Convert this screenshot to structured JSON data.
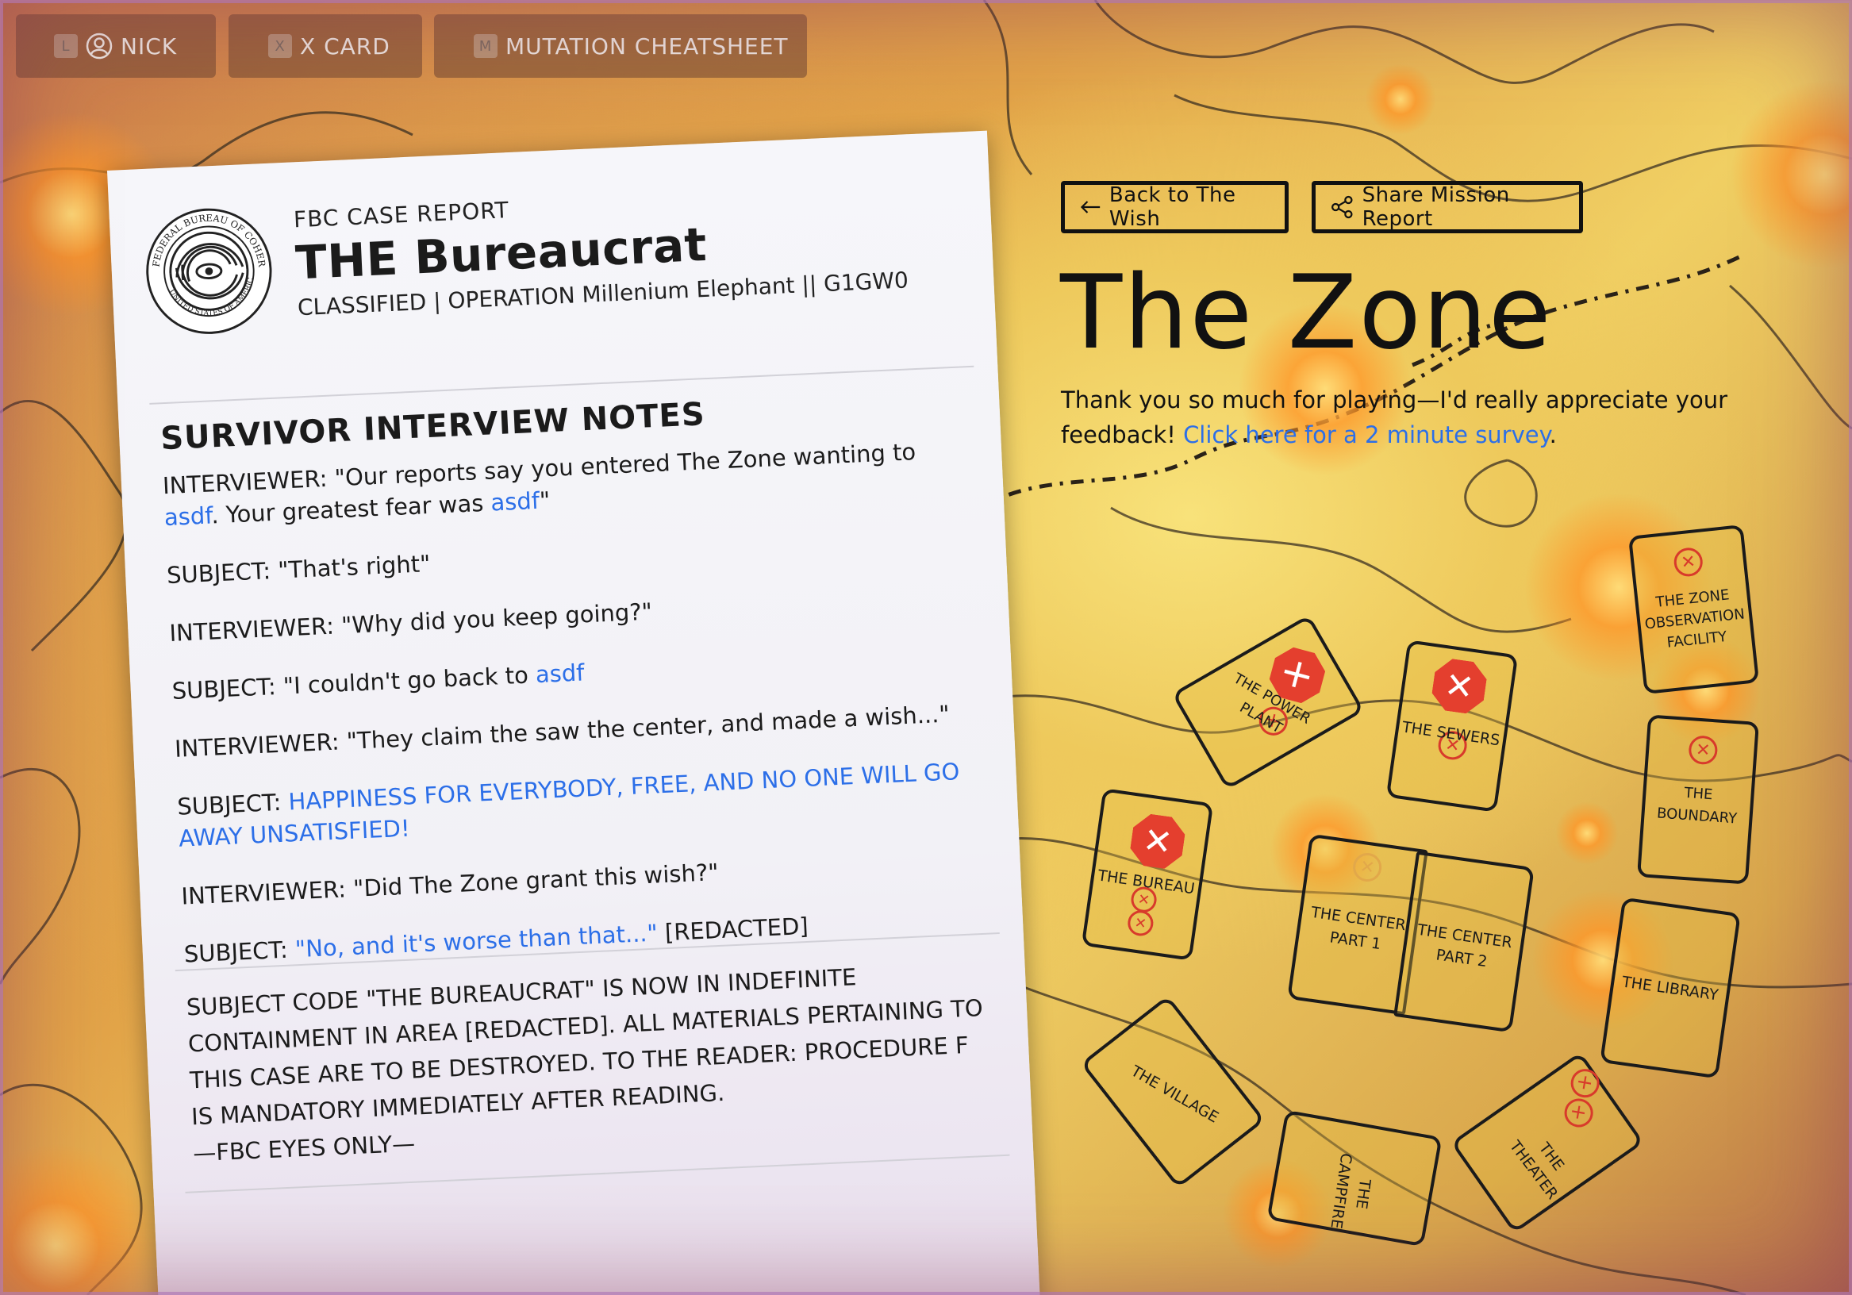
{
  "topbar": {
    "nick": {
      "key": "L",
      "label": "NICK"
    },
    "xcard": {
      "key": "X",
      "label": "X CARD"
    },
    "cheatsheet": {
      "key": "M",
      "label": "MUTATION CHEATSHEET"
    }
  },
  "report": {
    "seal_text": "FEDERAL BUREAU OF COHERENCE",
    "seal_text_bottom": "UNITED STATES OF AMERICA",
    "kicker": "FBC CASE REPORT",
    "title": "THE Bureaucrat",
    "classified": "CLASSIFIED | OPERATION Millenium Elephant || G1GW0",
    "section_title": "SURVIVOR INTERVIEW NOTES",
    "lines": [
      {
        "prefix": "INTERVIEWER: \"Our reports say you entered The Zone wanting to ",
        "hl": "asdf",
        "suffix": ". Your greatest fear was ",
        "hl2": "asdf",
        "suffix2": "\""
      },
      {
        "prefix": "SUBJECT: \"That's right\""
      },
      {
        "prefix": "INTERVIEWER: \"Why did you keep going?\""
      },
      {
        "prefix": "SUBJECT: \"I couldn't go back to ",
        "hl": "asdf"
      },
      {
        "prefix": "INTERVIEWER: \"They claim the saw the center, and made a wish...\""
      },
      {
        "prefix": "SUBJECT: ",
        "hl": "HAPPINESS FOR EVERYBODY, FREE, AND NO ONE WILL GO AWAY UNSATISFIED!"
      },
      {
        "prefix": "INTERVIEWER: \"Did The Zone grant this wish?\""
      },
      {
        "prefix": "SUBJECT: ",
        "hl": "\"No, and it's worse than that...\"",
        "suffix": " [REDACTED]"
      }
    ],
    "closing": "SUBJECT CODE \"THE BUREAUCRAT\" IS NOW IN INDEFINITE CONTAINMENT IN AREA [REDACTED]. ALL MATERIALS PERTAINING TO THIS CASE ARE TO BE DESTROYED. TO THE READER: PROCEDURE F IS MANDATORY IMMEDIATELY AFTER READING.",
    "signoff": "—FBC EYES ONLY—"
  },
  "panel": {
    "back_label": "Back to The Wish",
    "share_label": "Share Mission Report",
    "zone_title": "The Zone",
    "thanks_text": "Thank you so much for playing—I'd really appreciate your feedback! ",
    "survey_link": "Click here for a 2 minute survey",
    "thanks_end": "."
  },
  "map_tiles": [
    {
      "id": "observation",
      "label": "The Zone Observation Facility",
      "marks": 1
    },
    {
      "id": "power-plant",
      "label": "The Power Plant",
      "marks": 2
    },
    {
      "id": "sewers",
      "label": "The Sewers",
      "marks": 2
    },
    {
      "id": "boundary",
      "label": "The Boundary",
      "marks": 1
    },
    {
      "id": "bureau",
      "label": "The Bureau",
      "marks": 3
    },
    {
      "id": "center-1",
      "label": "The Center Part 1",
      "marks": 1
    },
    {
      "id": "center-2",
      "label": "The Center Part 2",
      "marks": 0
    },
    {
      "id": "library",
      "label": "The Library",
      "marks": 0
    },
    {
      "id": "village",
      "label": "The Village",
      "marks": 0
    },
    {
      "id": "campfire",
      "label": "The Campfire",
      "marks": 0
    },
    {
      "id": "theater",
      "label": "The Theater",
      "marks": 2
    }
  ],
  "icons": {
    "avatar": "user-circle-icon",
    "back": "arrow-left-icon",
    "share": "share-icon",
    "stop": "stop-x-icon"
  },
  "colors": {
    "link": "#2c6fe8",
    "stop_red": "#e43f2e",
    "ink": "#111111"
  }
}
